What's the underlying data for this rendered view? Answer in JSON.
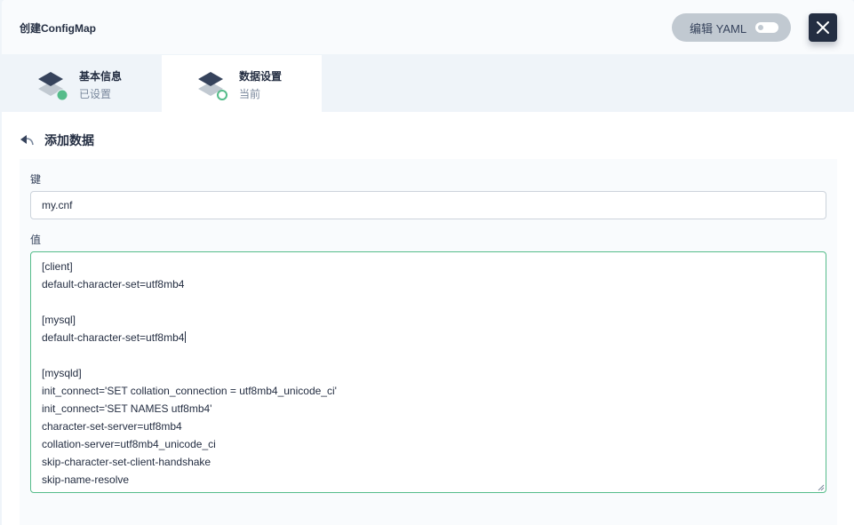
{
  "header": {
    "title": "创建ConfigMap",
    "yaml_label": "编辑 YAML",
    "close_icon": "close-icon"
  },
  "steps": [
    {
      "name": "基本信息",
      "status": "已设置",
      "icon": "layers-icon",
      "state": "done"
    },
    {
      "name": "数据设置",
      "status": "当前",
      "icon": "layers-icon",
      "state": "current"
    }
  ],
  "form": {
    "back_label": "添加数据",
    "key_label": "键",
    "key_value": "my.cnf",
    "value_label": "值",
    "value_lines": [
      "[client]",
      "default-character-set=utf8mb4",
      "",
      "[mysql]",
      "default-character-set=utf8mb4",
      "",
      "[mysqld]",
      "init_connect='SET collation_connection = utf8mb4_unicode_ci'",
      "init_connect='SET NAMES utf8mb4'",
      "character-set-server=utf8mb4",
      "collation-server=utf8mb4_unicode_ci",
      "skip-character-set-client-handshake",
      "skip-name-resolve"
    ]
  },
  "colors": {
    "accent_green": "#55bc8a",
    "dark": "#242e42",
    "muted": "#79879c"
  }
}
